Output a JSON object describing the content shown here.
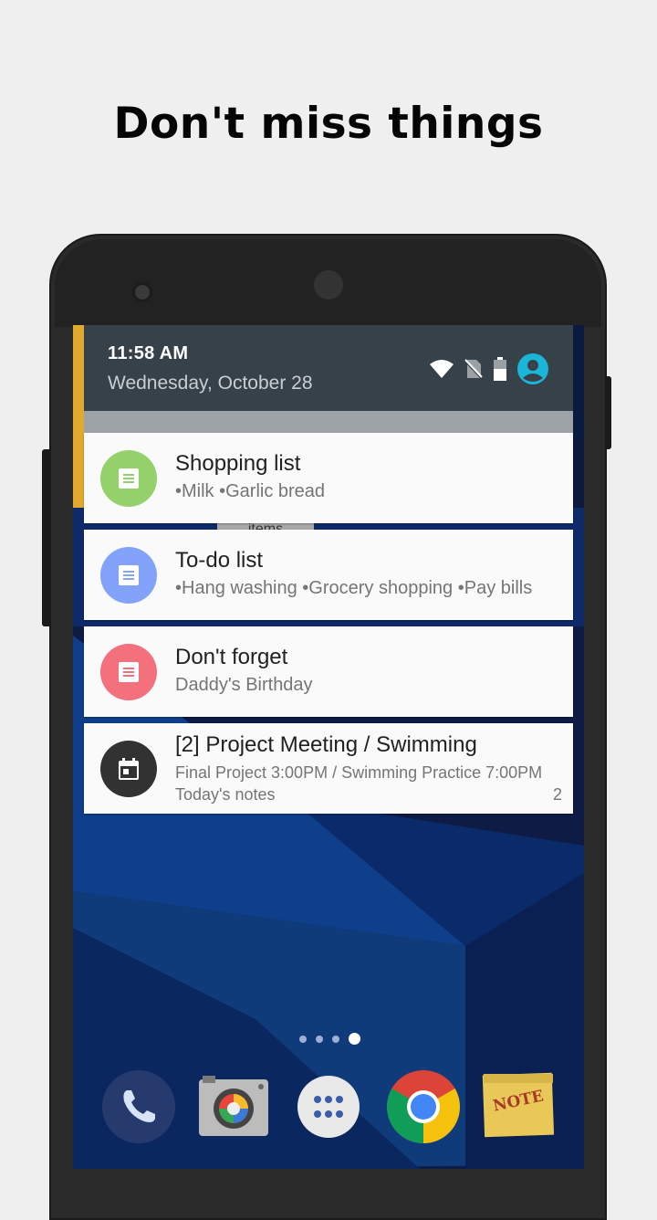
{
  "headline": "Don't miss things",
  "status": {
    "time": "11:58 AM",
    "date": "Wednesday, October 28",
    "icons": [
      "wifi-icon",
      "no-sim-icon",
      "battery-icon",
      "account-icon"
    ]
  },
  "background_peek": {
    "label": "items"
  },
  "notifications": [
    {
      "title": "Shopping list",
      "text": "•Milk •Garlic bread",
      "icon": "note-icon",
      "color": "#94d16b"
    },
    {
      "title": "To-do list",
      "text": "•Hang washing •Grocery shopping •Pay bills",
      "icon": "note-icon",
      "color": "#83a3fb"
    },
    {
      "title": "Don't forget",
      "text": "Daddy's Birthday",
      "icon": "note-icon",
      "color": "#f3707d"
    },
    {
      "title": "[2] Project Meeting / Swimming",
      "text": "Final Project 3:00PM / Swimming Practice 7:00PM",
      "subtext": "Today's notes",
      "count": "2",
      "icon": "calendar-icon",
      "color": "#323232"
    }
  ],
  "home": {
    "page_dots": 4,
    "active_dot": 3,
    "dock": [
      "phone-icon",
      "camera-icon",
      "app-drawer-icon",
      "chrome-icon",
      "note-app-icon"
    ],
    "note_app_label": "NOTE"
  }
}
